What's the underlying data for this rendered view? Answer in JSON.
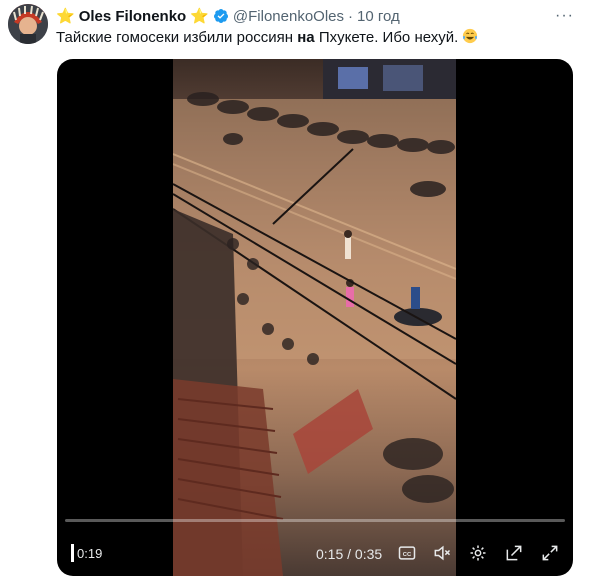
{
  "tweet": {
    "author_name": "Oles Filonenko",
    "star_left": "⭐",
    "star_right": "⭐",
    "handle": "@FilonenkoOles",
    "separator": "·",
    "time": "10 год",
    "text_before": "Тайские гомосеки избили россиян ",
    "text_bold": "на",
    "text_after": " Пхукете. Ибо нехуй.",
    "more_label": "···"
  },
  "video": {
    "progress_fraction": 0.0,
    "elapsed_label": "0:19",
    "timecode": "0:15 / 0:35",
    "controls": [
      "cc-icon",
      "mute-icon",
      "settings-icon",
      "popout-icon",
      "fullscreen-icon"
    ]
  },
  "colors": {
    "verified": "#1d9bf0",
    "accent_text": "#536471"
  }
}
